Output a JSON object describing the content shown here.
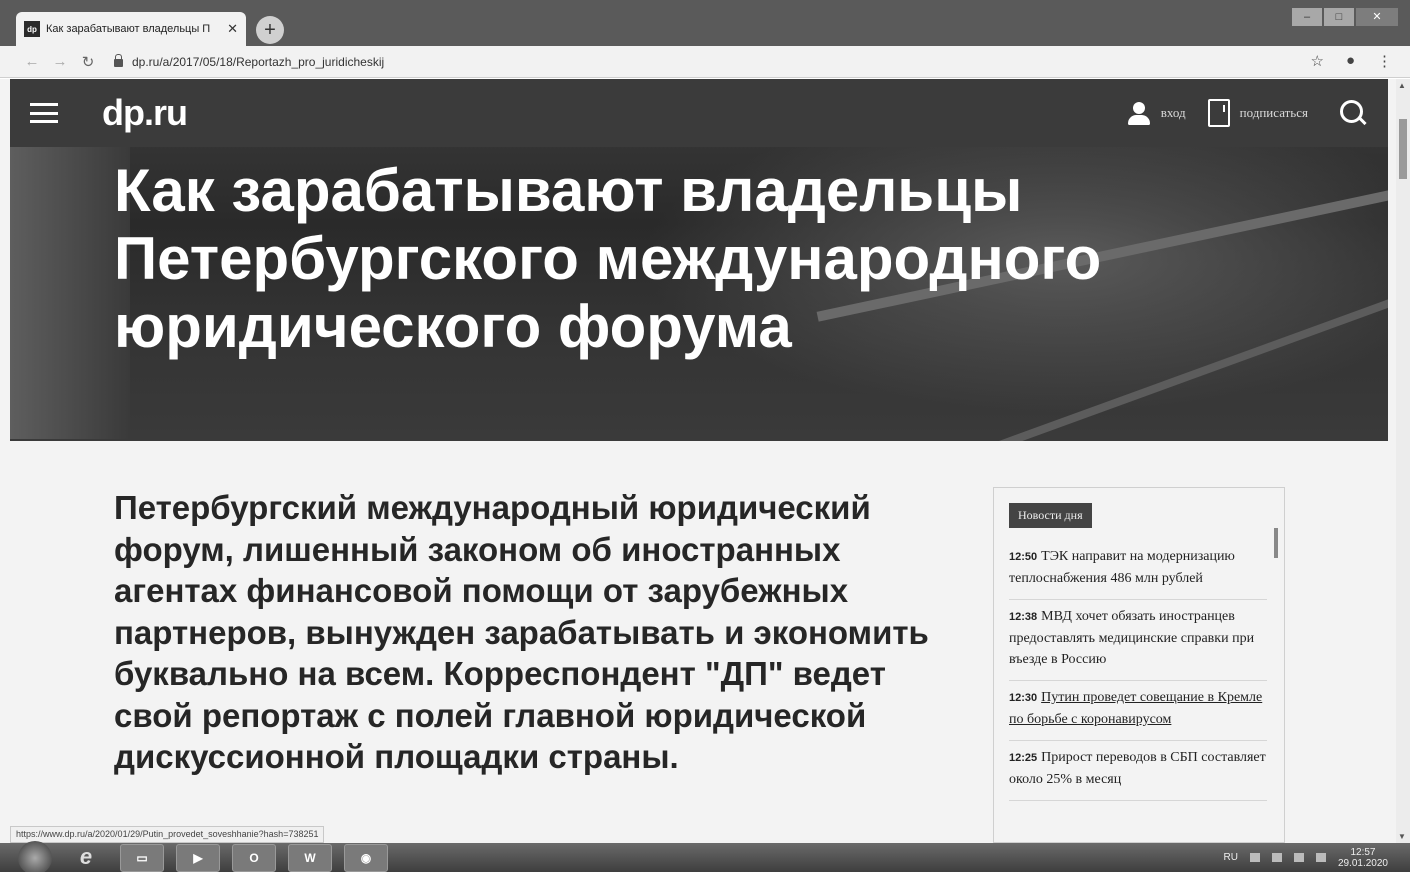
{
  "browser": {
    "tab_title": "Как зарабатывают владельцы П",
    "tab_favicon": "dp",
    "url": "dp.ru/a/2017/05/18/Reportazh_pro_juridicheskij",
    "status_url": "https://www.dp.ru/a/2020/01/29/Putin_provedet_soveshhanie?hash=738251"
  },
  "site": {
    "logo": "dp.ru",
    "login_label": "вход",
    "subscribe_label": "подписаться"
  },
  "article": {
    "title": "Как зарабатывают владельцы Петербургского международного юридического форума",
    "lead": "Петербургский международный юридический форум, лишенный законом об иностранных агентах финансовой помощи от зарубежных партнеров, вынужден зарабатывать и экономить буквально на всем. Корреспондент \"ДП\" ведет свой репортаж с полей главной юридической дискуссионной площадки страны."
  },
  "news": {
    "badge": "Новости дня",
    "items": [
      {
        "time": "12:50",
        "text": "ТЭК направит на модернизацию теплоснабжения 486 млн рублей"
      },
      {
        "time": "12:38",
        "text": "МВД хочет обязать иностранцев предоставлять медицинские справки при въезде в Россию"
      },
      {
        "time": "12:30",
        "text": "Путин проведет совещание в Кремле по борьбе с коронавирусом"
      },
      {
        "time": "12:25",
        "text": "Прирост переводов в СБП составляет около 25% в месяц"
      }
    ]
  },
  "taskbar": {
    "lang": "RU",
    "time": "12:57",
    "date": "29.01.2020"
  },
  "icons": [
    "menu-icon",
    "user-icon",
    "subscribe-doc-icon",
    "search-icon",
    "back-icon",
    "forward-icon",
    "reload-icon",
    "lock-icon",
    "star-icon",
    "account-icon",
    "more-icon",
    "close-icon",
    "plus-icon"
  ]
}
